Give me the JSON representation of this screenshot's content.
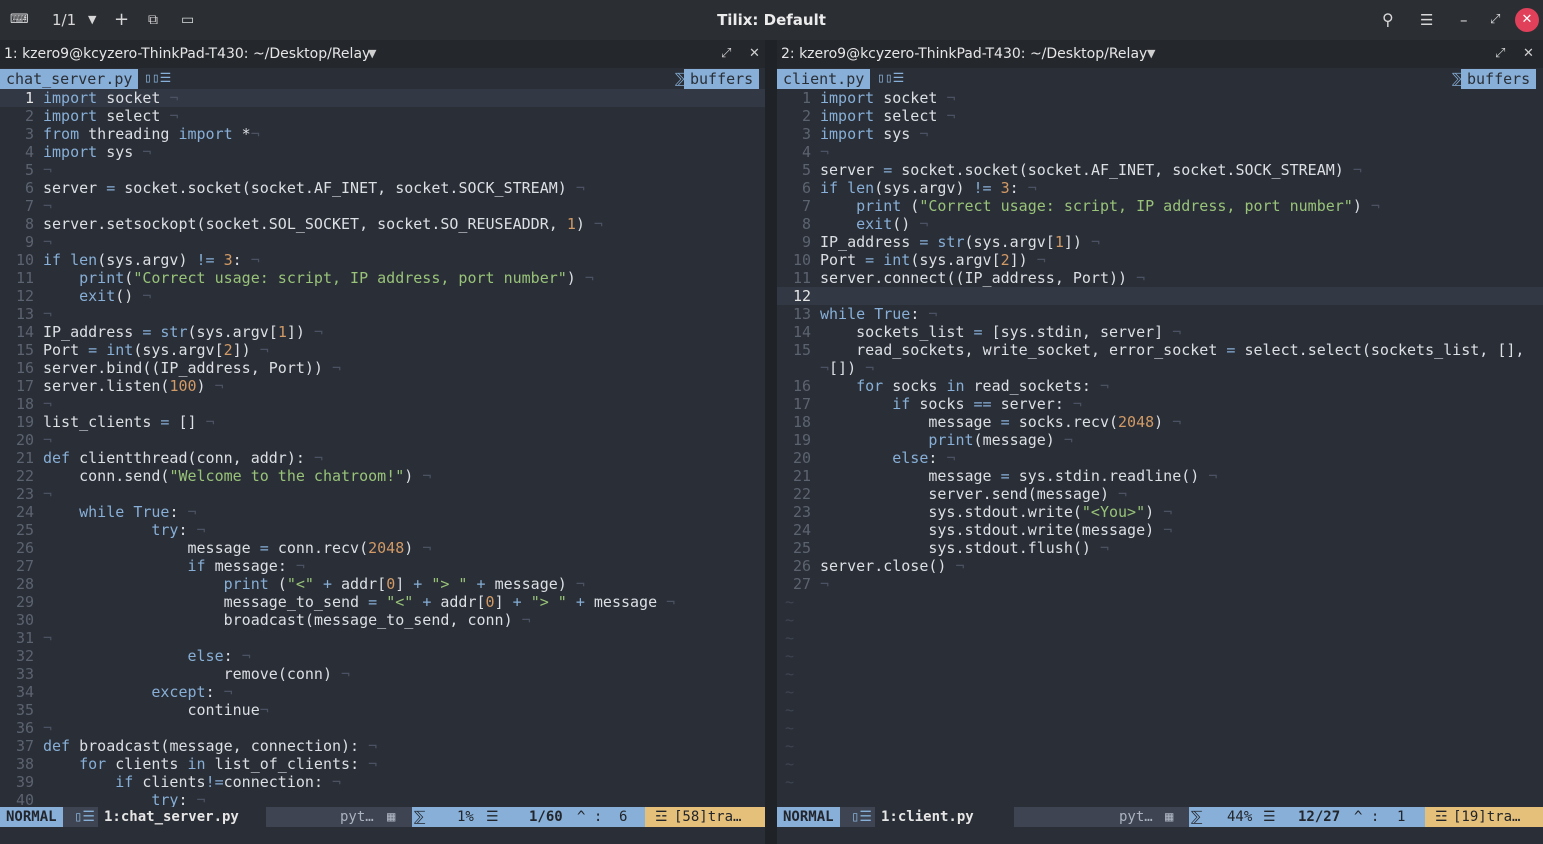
{
  "window": {
    "title": "Tilix: Default",
    "session_counter": "1/1",
    "icons": [
      "terminal-icon",
      "add-icon",
      "detach-icon",
      "sync-input-icon",
      "search-icon",
      "menu-icon",
      "minimize-icon",
      "maximize-icon",
      "close-icon"
    ]
  },
  "panes": [
    {
      "title": "1: kzero9@kcyzero-ThinkPad-T430: ~/Desktop/Relay",
      "tab_file": "chat_server.py",
      "tab_buffers": "buffers",
      "current_line": 1,
      "lines": [
        "import socket ¬",
        "import select ¬",
        "from threading import *¬",
        "import sys ¬",
        "¬",
        "server = socket.socket(socket.AF_INET, socket.SOCK_STREAM) ¬",
        "¬",
        "server.setsockopt(socket.SOL_SOCKET, socket.SO_REUSEADDR, 1) ¬",
        "¬",
        "if len(sys.argv) != 3: ¬",
        "    print(\"Correct usage: script, IP address, port number\") ¬",
        "    exit() ¬",
        "¬",
        "IP_address = str(sys.argv[1]) ¬",
        "Port = int(sys.argv[2]) ¬",
        "server.bind((IP_address, Port)) ¬",
        "server.listen(100) ¬",
        "¬",
        "list_clients = [] ¬",
        "¬",
        "def clientthread(conn, addr): ¬",
        "    conn.send(\"Welcome to the chatroom!\") ¬",
        "¬",
        "    while True: ¬",
        "            try: ¬",
        "                message = conn.recv(2048) ¬",
        "                if message: ¬",
        "                    print (\"<\" + addr[0] + \"> \" + message) ¬",
        "                    message_to_send = \"<\" + addr[0] + \"> \" + message ¬",
        "                    broadcast(message_to_send, conn) ¬",
        "¬",
        "                else: ¬",
        "                    remove(conn) ¬",
        "            except: ¬",
        "                continue¬",
        "¬",
        "def broadcast(message, connection): ¬",
        "    for clients in list_of_clients: ¬",
        "        if clients!=connection: ¬",
        "            try: ¬"
      ],
      "tildes": 0,
      "status": {
        "mode": "NORMAL",
        "file": "1:chat_server.py",
        "filetype": "pyt…",
        "percent": "1%",
        "position": "1/60",
        "column": "6",
        "warning": "[58]tra…"
      }
    },
    {
      "title": "2: kzero9@kcyzero-ThinkPad-T430: ~/Desktop/Relay",
      "tab_file": "client.py",
      "tab_buffers": "buffers",
      "current_line": 12,
      "lines": [
        "import socket ¬",
        "import select ¬",
        "import sys ¬",
        "¬",
        "server = socket.socket(socket.AF_INET, socket.SOCK_STREAM) ¬",
        "if len(sys.argv) != 3: ¬",
        "    print (\"Correct usage: script, IP address, port number\") ¬",
        "    exit() ¬",
        "IP_address = str(sys.argv[1]) ¬",
        "Port = int(sys.argv[2]) ¬",
        "server.connect((IP_address, Port)) ¬",
        " ",
        "while True: ¬",
        "    sockets_list = [sys.stdin, server] ¬",
        "    read_sockets, write_socket, error_socket = select.select(sockets_list, [],",
        "¬[]) ¬",
        "    for socks in read_sockets: ¬",
        "        if socks == server: ¬",
        "            message = socks.recv(2048) ¬",
        "            print(message) ¬",
        "        else: ¬",
        "            message = sys.stdin.readline() ¬",
        "            server.send(message) ¬",
        "            sys.stdout.write(\"<You>\") ¬",
        "            sys.stdout.write(message) ¬",
        "            sys.stdout.flush() ¬",
        "server.close() ¬",
        "¬"
      ],
      "line_numbers": [
        "1",
        "2",
        "3",
        "4",
        "5",
        "6",
        "7",
        "8",
        "9",
        "10",
        "11",
        "12",
        "13",
        "14",
        "15",
        "",
        "16",
        "17",
        "18",
        "19",
        "20",
        "21",
        "22",
        "23",
        "24",
        "25",
        "26",
        "27"
      ],
      "tildes": 11,
      "status": {
        "mode": "NORMAL",
        "file": "1:client.py",
        "filetype": "pyt…",
        "percent": "44%",
        "position": "12/27",
        "column": "1",
        "warning": "[19]tra…"
      }
    }
  ]
}
